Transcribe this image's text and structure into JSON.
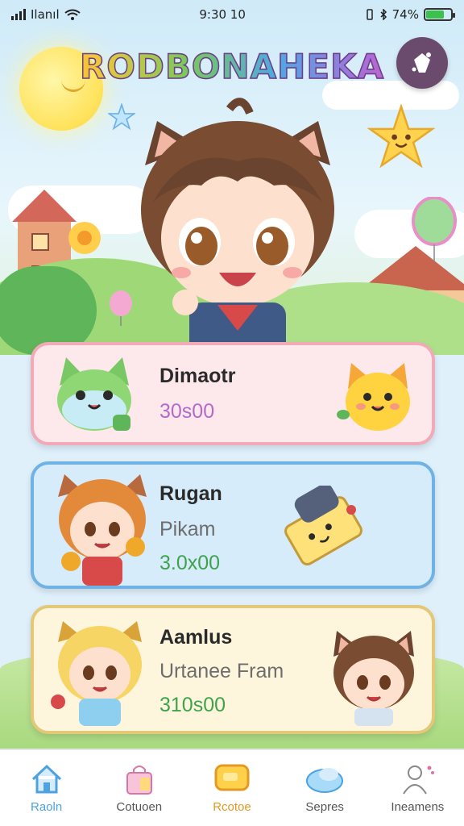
{
  "status": {
    "carrier": "Ilanıl",
    "time": "9:30 10",
    "battery_text": "74%",
    "battery_level": 0.74
  },
  "app": {
    "title": "RODBONAHEKA"
  },
  "cards": [
    {
      "name": "Dimaotr",
      "subtitle": "",
      "price": "30s00",
      "color": "#f2a9b8",
      "bg": "#fde8ec",
      "price_color": "#b36ac9"
    },
    {
      "name": "Rugan",
      "subtitle": "Pikam",
      "price": "3.0x00",
      "color": "#6fb2e5",
      "bg": "#d6ecfa",
      "price_color": "#3fa34d"
    },
    {
      "name": "Aamlus",
      "subtitle": "Urtanee Fram",
      "price": "310s00",
      "color": "#e4c777",
      "bg": "#fdf6dc",
      "price_color": "#3fa34d"
    }
  ],
  "tabs": [
    {
      "label": "Raoln",
      "icon": "home-icon"
    },
    {
      "label": "Cotuoen",
      "icon": "shopping-bag-icon"
    },
    {
      "label": "Rcotoe",
      "icon": "chat-bubble-icon"
    },
    {
      "label": "Sepres",
      "icon": "cloud-shoe-icon"
    },
    {
      "label": "Ineamens",
      "icon": "person-icon"
    }
  ]
}
